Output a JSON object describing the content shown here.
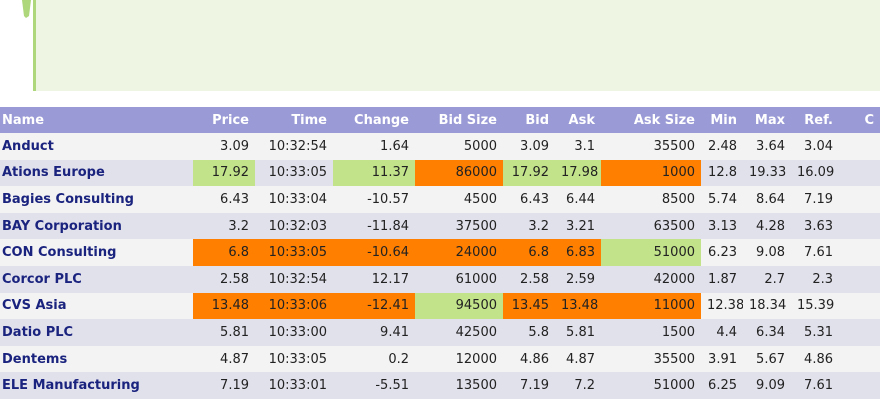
{
  "colors": {
    "header": "#9a9ad6",
    "up": "#c2e38a",
    "down": "#ff7f00",
    "name_text": "#1a237e"
  },
  "columns": [
    "Name",
    "Price",
    "Time",
    "Change",
    "Bid Size",
    "Bid",
    "Ask",
    "Ask Size",
    "Min",
    "Max",
    "Ref.",
    "C"
  ],
  "rows": [
    {
      "name": "Anduct",
      "price": "3.09",
      "time": "10:32:54",
      "change": "1.64",
      "bid_size": "5000",
      "bid": "3.09",
      "ask": "3.1",
      "ask_size": "35500",
      "min": "2.48",
      "max": "3.64",
      "ref": "3.04"
    },
    {
      "name": "Ations Europe",
      "price": "17.92",
      "time": "10:33:05",
      "change": "11.37",
      "bid_size": "86000",
      "bid": "17.92",
      "ask": "17.98",
      "ask_size": "1000",
      "min": "12.8",
      "max": "19.33",
      "ref": "16.09"
    },
    {
      "name": "Bagies Consulting",
      "price": "6.43",
      "time": "10:33:04",
      "change": "-10.57",
      "bid_size": "4500",
      "bid": "6.43",
      "ask": "6.44",
      "ask_size": "8500",
      "min": "5.74",
      "max": "8.64",
      "ref": "7.19"
    },
    {
      "name": "BAY Corporation",
      "price": "3.2",
      "time": "10:32:03",
      "change": "-11.84",
      "bid_size": "37500",
      "bid": "3.2",
      "ask": "3.21",
      "ask_size": "63500",
      "min": "3.13",
      "max": "4.28",
      "ref": "3.63"
    },
    {
      "name": "CON Consulting",
      "price": "6.8",
      "time": "10:33:05",
      "change": "-10.64",
      "bid_size": "24000",
      "bid": "6.8",
      "ask": "6.83",
      "ask_size": "51000",
      "min": "6.23",
      "max": "9.08",
      "ref": "7.61"
    },
    {
      "name": "Corcor PLC",
      "price": "2.58",
      "time": "10:32:54",
      "change": "12.17",
      "bid_size": "61000",
      "bid": "2.58",
      "ask": "2.59",
      "ask_size": "42000",
      "min": "1.87",
      "max": "2.7",
      "ref": "2.3"
    },
    {
      "name": "CVS Asia",
      "price": "13.48",
      "time": "10:33:06",
      "change": "-12.41",
      "bid_size": "94500",
      "bid": "13.45",
      "ask": "13.48",
      "ask_size": "11000",
      "min": "12.38",
      "max": "18.34",
      "ref": "15.39"
    },
    {
      "name": "Datio PLC",
      "price": "5.81",
      "time": "10:33:00",
      "change": "9.41",
      "bid_size": "42500",
      "bid": "5.8",
      "ask": "5.81",
      "ask_size": "1500",
      "min": "4.4",
      "max": "6.34",
      "ref": "5.31"
    },
    {
      "name": "Dentems",
      "price": "4.87",
      "time": "10:33:05",
      "change": "0.2",
      "bid_size": "12000",
      "bid": "4.86",
      "ask": "4.87",
      "ask_size": "35500",
      "min": "3.91",
      "max": "5.67",
      "ref": "4.86"
    },
    {
      "name": "ELE Manufacturing",
      "price": "7.19",
      "time": "10:33:01",
      "change": "-5.51",
      "bid_size": "13500",
      "bid": "7.19",
      "ask": "7.2",
      "ask_size": "51000",
      "min": "6.25",
      "max": "9.09",
      "ref": "7.61"
    }
  ],
  "highlights": [
    {
      "row": 1,
      "col": "price",
      "state": "up"
    },
    {
      "row": 1,
      "col": "change",
      "state": "up"
    },
    {
      "row": 1,
      "col": "bid_size",
      "state": "down"
    },
    {
      "row": 1,
      "col": "bid",
      "state": "up"
    },
    {
      "row": 1,
      "col": "ask",
      "state": "up"
    },
    {
      "row": 1,
      "col": "ask_size",
      "state": "down"
    },
    {
      "row": 4,
      "col": "price",
      "state": "down"
    },
    {
      "row": 4,
      "col": "time",
      "state": "down"
    },
    {
      "row": 4,
      "col": "change",
      "state": "down"
    },
    {
      "row": 4,
      "col": "bid_size",
      "state": "down"
    },
    {
      "row": 4,
      "col": "bid",
      "state": "down"
    },
    {
      "row": 4,
      "col": "ask",
      "state": "down"
    },
    {
      "row": 4,
      "col": "ask_size",
      "state": "up"
    },
    {
      "row": 6,
      "col": "price",
      "state": "down"
    },
    {
      "row": 6,
      "col": "time",
      "state": "down"
    },
    {
      "row": 6,
      "col": "change",
      "state": "down"
    },
    {
      "row": 6,
      "col": "bid_size",
      "state": "up"
    },
    {
      "row": 6,
      "col": "bid",
      "state": "down"
    },
    {
      "row": 6,
      "col": "ask",
      "state": "down"
    },
    {
      "row": 6,
      "col": "ask_size",
      "state": "down"
    }
  ]
}
